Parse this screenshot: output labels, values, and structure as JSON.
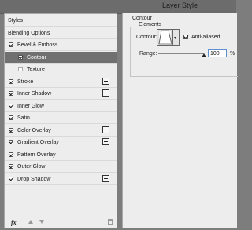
{
  "window": {
    "title": "Layer Style"
  },
  "styles_list": {
    "items": [
      {
        "label": "Styles",
        "type": "plain"
      },
      {
        "label": "Blending Options",
        "type": "plain"
      },
      {
        "label": "Bevel & Emboss",
        "type": "check",
        "checked": true
      },
      {
        "label": "Contour",
        "type": "sub",
        "checked": true,
        "selected": true
      },
      {
        "label": "Texture",
        "type": "sub",
        "checked": false
      },
      {
        "label": "Stroke",
        "type": "check",
        "checked": true,
        "plus": true
      },
      {
        "label": "Inner Shadow",
        "type": "check",
        "checked": true,
        "plus": true
      },
      {
        "label": "Inner Glow",
        "type": "check",
        "checked": true
      },
      {
        "label": "Satin",
        "type": "check",
        "checked": true
      },
      {
        "label": "Color Overlay",
        "type": "check",
        "checked": true,
        "plus": true
      },
      {
        "label": "Gradient Overlay",
        "type": "check",
        "checked": true,
        "plus": true
      },
      {
        "label": "Pattern Overlay",
        "type": "check",
        "checked": true
      },
      {
        "label": "Outer Glow",
        "type": "check",
        "checked": true
      },
      {
        "label": "Drop Shadow",
        "type": "check",
        "checked": true,
        "plus": true
      }
    ]
  },
  "bottom_bar": {
    "fx_label": "fx"
  },
  "contour_panel": {
    "section_title": "Contour",
    "group_title": "Elements",
    "contour_label": "Contour:",
    "anti_aliased_label": "Anti-aliased",
    "anti_aliased_checked": true,
    "range_label": "Range:",
    "range_value": "100",
    "range_unit": "%"
  }
}
